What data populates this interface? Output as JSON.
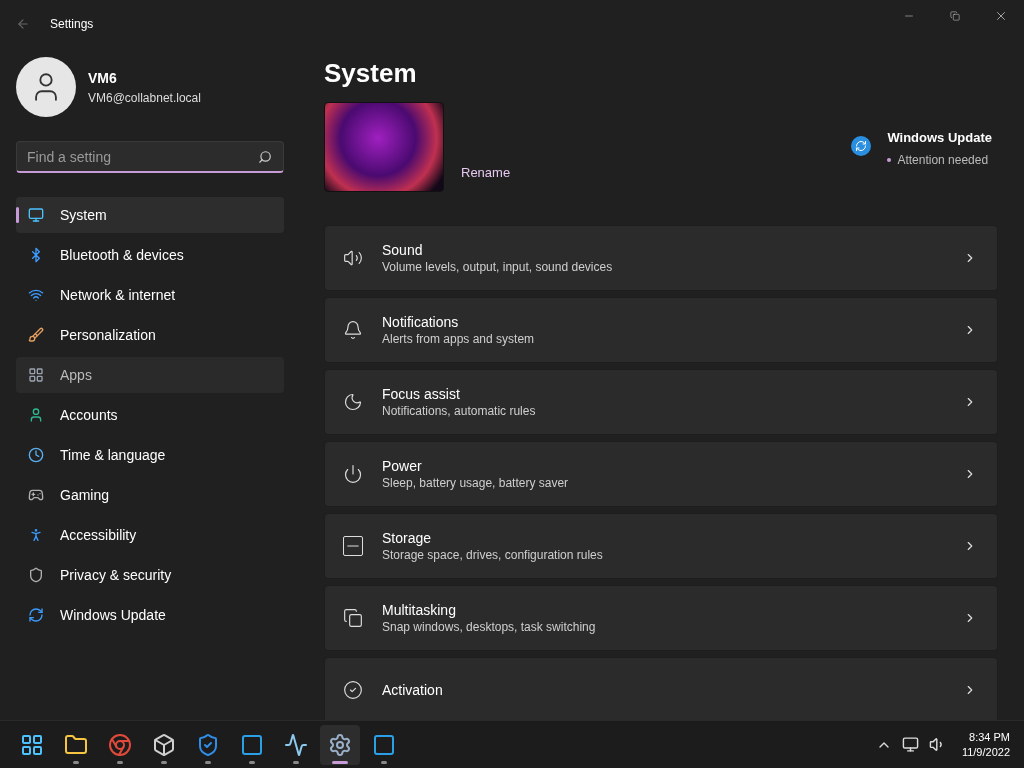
{
  "window": {
    "title": "Settings"
  },
  "account": {
    "name": "VM6",
    "email": "VM6@collabnet.local"
  },
  "search": {
    "placeholder": "Find a setting"
  },
  "sidebar": {
    "items": [
      {
        "label": "System",
        "selected": true,
        "hovered": false
      },
      {
        "label": "Bluetooth & devices",
        "selected": false,
        "hovered": false
      },
      {
        "label": "Network & internet",
        "selected": false,
        "hovered": false
      },
      {
        "label": "Personalization",
        "selected": false,
        "hovered": false
      },
      {
        "label": "Apps",
        "selected": false,
        "hovered": true
      },
      {
        "label": "Accounts",
        "selected": false,
        "hovered": false
      },
      {
        "label": "Time & language",
        "selected": false,
        "hovered": false
      },
      {
        "label": "Gaming",
        "selected": false,
        "hovered": false
      },
      {
        "label": "Accessibility",
        "selected": false,
        "hovered": false
      },
      {
        "label": "Privacy & security",
        "selected": false,
        "hovered": false
      },
      {
        "label": "Windows Update",
        "selected": false,
        "hovered": false
      }
    ]
  },
  "page": {
    "title": "System",
    "rename": "Rename",
    "update": {
      "title": "Windows Update",
      "status": "Attention needed"
    }
  },
  "cards": [
    {
      "title": "Sound",
      "subtitle": "Volume levels, output, input, sound devices"
    },
    {
      "title": "Notifications",
      "subtitle": "Alerts from apps and system"
    },
    {
      "title": "Focus assist",
      "subtitle": "Notifications, automatic rules"
    },
    {
      "title": "Power",
      "subtitle": "Sleep, battery usage, battery saver"
    },
    {
      "title": "Storage",
      "subtitle": "Storage space, drives, configuration rules"
    },
    {
      "title": "Multitasking",
      "subtitle": "Snap windows, desktops, task switching"
    },
    {
      "title": "Activation"
    }
  ],
  "taskbar": {
    "apps": [
      {
        "running": false,
        "active": false
      },
      {
        "running": true,
        "active": false
      },
      {
        "running": true,
        "active": false
      },
      {
        "running": true,
        "active": false
      },
      {
        "running": true,
        "active": false
      },
      {
        "running": true,
        "active": false
      },
      {
        "running": true,
        "active": false
      },
      {
        "running": true,
        "active": true
      },
      {
        "running": true,
        "active": false
      }
    ],
    "time": "8:34 PM",
    "date": "11/9/2022"
  }
}
